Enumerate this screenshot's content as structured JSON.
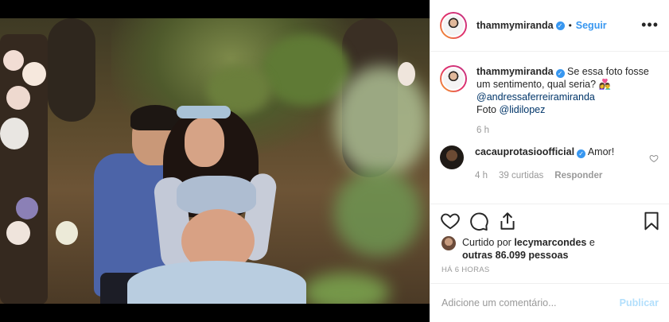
{
  "post": {
    "author": {
      "username": "thammymiranda",
      "verified": true,
      "follow_label": "Seguir",
      "more_icon": "more-options-icon"
    },
    "photo": {
      "alt": "Foto de gestante com parceiro em floresta"
    },
    "caption": {
      "username": "thammymiranda",
      "text": "Se essa foto fosse um sentimento, qual seria? 👩‍❤️‍👨",
      "mention1": "@andressaferreiramiranda",
      "credit_prefix": "Foto",
      "mention2": "@lidilopez",
      "time": "6 h"
    },
    "comments": [
      {
        "username": "cacauprotasioofficial",
        "verified": true,
        "text": "Amor!",
        "time": "4 h",
        "likes": "39 curtidas",
        "reply_label": "Responder"
      }
    ],
    "likes": {
      "prefix": "Curtido por",
      "user": "lecymarcondes",
      "conj": "e",
      "others": "outras 86.099 pessoas"
    },
    "timestamp": "HÁ 6 HORAS",
    "add_comment": {
      "placeholder": "Adicione um comentário...",
      "publish_label": "Publicar"
    },
    "colors": {
      "accent": "#3897f0",
      "publish_disabled": "#b2dffc",
      "muted": "#999999",
      "border": "#efefef"
    }
  }
}
